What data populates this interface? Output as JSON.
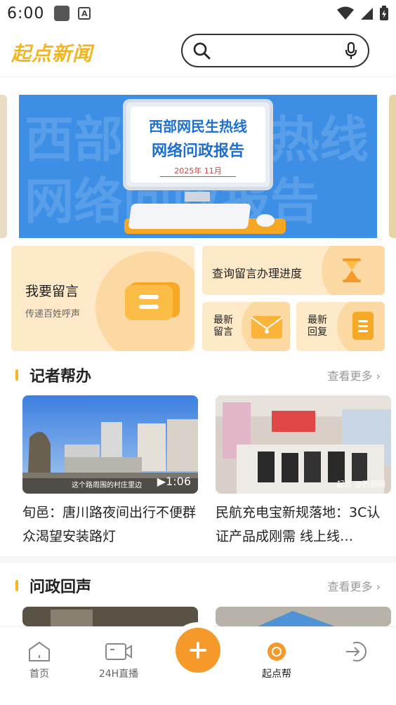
{
  "status_bar": {
    "time": "6:00",
    "a_label": "A"
  },
  "header": {
    "logo": "起点新闻"
  },
  "banner": {
    "bg_text_1": "西部网民生热线",
    "bg_text_2": "网络问政报告",
    "line1": "西部网民生热线",
    "line2": "网络问政报告",
    "date": "2025年 11月"
  },
  "actions": {
    "leave_message": {
      "title": "我要留言",
      "subtitle": "传递百姓呼声"
    },
    "query_progress": {
      "title": "查询留言办理进度"
    },
    "latest_message": {
      "label": "最新留言"
    },
    "latest_reply": {
      "label": "最新回复"
    }
  },
  "sections": {
    "reporter_help": {
      "title": "记者帮办",
      "more": "查看更多 ›",
      "items": [
        {
          "title": "旬邑：唐川路夜间出行不便群众渴望安装路灯",
          "duration": "▶1:06",
          "caption": "这个路周围的村庄里边"
        },
        {
          "title": "民航充电宝新规落地：3C认证产品成刚需  线上线…",
          "watermark": "起点 @西部网"
        }
      ]
    },
    "inquiry_echo": {
      "title": "问政回声",
      "more": "查看更多 ›"
    }
  },
  "bottom_nav": {
    "items": [
      {
        "label": "首页"
      },
      {
        "label": "24H直播"
      },
      {
        "label": "起点帮"
      },
      {
        "label": ""
      }
    ]
  },
  "colors": {
    "accent": "#f59a2a",
    "brand_yellow": "#f2b622",
    "card_bg": "#fde9c8",
    "banner_blue": "#3d8fe6"
  }
}
